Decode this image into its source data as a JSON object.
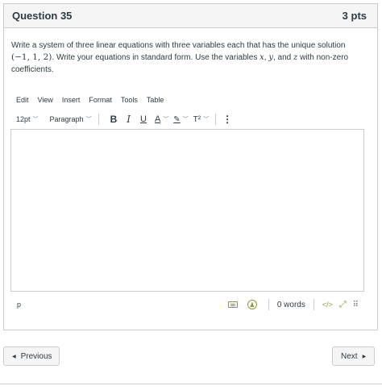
{
  "question": {
    "title": "Question 35",
    "points": "3 pts",
    "text_part1": "Write a system of three linear equations with three variables each that has the unique solution",
    "solution": "(−1, 1, 2)",
    "text_part2": ". Write your equations in standard form. Use the variables",
    "var_x": "x",
    "comma1": ",",
    "var_y": "y",
    "and_text": ", and",
    "var_z": "z",
    "text_part3": "with non-zero coefficients."
  },
  "menubar": {
    "edit": "Edit",
    "view": "View",
    "insert": "Insert",
    "format": "Format",
    "tools": "Tools",
    "table": "Table"
  },
  "toolbar": {
    "font_size": "12pt",
    "block_format": "Paragraph",
    "bold": "B",
    "italic": "I",
    "underline": "U",
    "text_color": "A",
    "highlight": "✎",
    "superscript": "T²",
    "more": "⋮"
  },
  "editor": {
    "content": ""
  },
  "statusbar": {
    "path": "p",
    "word_count": "0 words",
    "code_view": "</>",
    "expand": "⤢",
    "grip": "⠿"
  },
  "navigation": {
    "previous": "Previous",
    "next": "Next"
  },
  "colors": {
    "accent_icon": "#8a9a3a",
    "border": "#c7cdd1",
    "text": "#2d3b45",
    "header_bg": "#f5f5f5"
  },
  "icons": {
    "previous": "triangle-left-icon",
    "next": "triangle-right-icon",
    "keyboard": "keyboard-icon",
    "accessibility": "accessibility-icon",
    "code": "code-view-icon",
    "fullscreen": "fullscreen-icon",
    "resize": "resize-grip-icon"
  }
}
